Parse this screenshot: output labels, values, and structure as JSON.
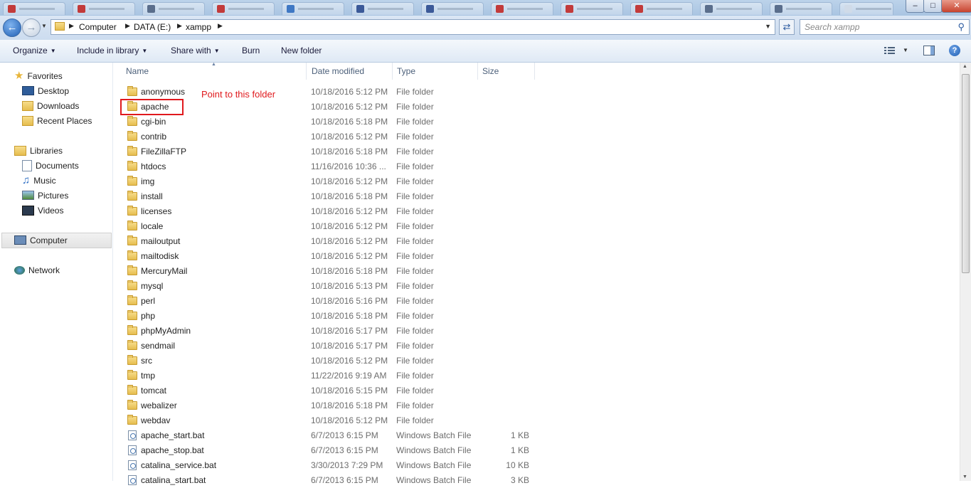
{
  "window": {
    "controls": [
      "–",
      "□",
      "✕"
    ]
  },
  "nav": {
    "back_icon": "back-arrow-icon",
    "forward_icon": "forward-arrow-icon"
  },
  "address": {
    "breadcrumbs": [
      "Computer",
      "DATA (E:)",
      "xampp"
    ]
  },
  "search": {
    "placeholder": "Search xampp"
  },
  "toolbar": {
    "organize": "Organize",
    "include": "Include in library",
    "share": "Share with",
    "burn": "Burn",
    "new_folder": "New folder"
  },
  "sidebar": {
    "favorites": "Favorites",
    "desktop": "Desktop",
    "downloads": "Downloads",
    "recent": "Recent Places",
    "libraries": "Libraries",
    "documents": "Documents",
    "music": "Music",
    "pictures": "Pictures",
    "videos": "Videos",
    "computer": "Computer",
    "network": "Network"
  },
  "columns": {
    "name": "Name",
    "date": "Date modified",
    "type": "Type",
    "size": "Size"
  },
  "files": [
    {
      "name": "anonymous",
      "date": "10/18/2016 5:12 PM",
      "type": "File folder",
      "size": "",
      "kind": "folder"
    },
    {
      "name": "apache",
      "date": "10/18/2016 5:12 PM",
      "type": "File folder",
      "size": "",
      "kind": "folder"
    },
    {
      "name": "cgi-bin",
      "date": "10/18/2016 5:18 PM",
      "type": "File folder",
      "size": "",
      "kind": "folder"
    },
    {
      "name": "contrib",
      "date": "10/18/2016 5:12 PM",
      "type": "File folder",
      "size": "",
      "kind": "folder"
    },
    {
      "name": "FileZillaFTP",
      "date": "10/18/2016 5:18 PM",
      "type": "File folder",
      "size": "",
      "kind": "folder"
    },
    {
      "name": "htdocs",
      "date": "11/16/2016 10:36 ...",
      "type": "File folder",
      "size": "",
      "kind": "folder"
    },
    {
      "name": "img",
      "date": "10/18/2016 5:12 PM",
      "type": "File folder",
      "size": "",
      "kind": "folder"
    },
    {
      "name": "install",
      "date": "10/18/2016 5:18 PM",
      "type": "File folder",
      "size": "",
      "kind": "folder"
    },
    {
      "name": "licenses",
      "date": "10/18/2016 5:12 PM",
      "type": "File folder",
      "size": "",
      "kind": "folder"
    },
    {
      "name": "locale",
      "date": "10/18/2016 5:12 PM",
      "type": "File folder",
      "size": "",
      "kind": "folder"
    },
    {
      "name": "mailoutput",
      "date": "10/18/2016 5:12 PM",
      "type": "File folder",
      "size": "",
      "kind": "folder"
    },
    {
      "name": "mailtodisk",
      "date": "10/18/2016 5:12 PM",
      "type": "File folder",
      "size": "",
      "kind": "folder"
    },
    {
      "name": "MercuryMail",
      "date": "10/18/2016 5:18 PM",
      "type": "File folder",
      "size": "",
      "kind": "folder"
    },
    {
      "name": "mysql",
      "date": "10/18/2016 5:13 PM",
      "type": "File folder",
      "size": "",
      "kind": "folder"
    },
    {
      "name": "perl",
      "date": "10/18/2016 5:16 PM",
      "type": "File folder",
      "size": "",
      "kind": "folder"
    },
    {
      "name": "php",
      "date": "10/18/2016 5:18 PM",
      "type": "File folder",
      "size": "",
      "kind": "folder"
    },
    {
      "name": "phpMyAdmin",
      "date": "10/18/2016 5:17 PM",
      "type": "File folder",
      "size": "",
      "kind": "folder"
    },
    {
      "name": "sendmail",
      "date": "10/18/2016 5:17 PM",
      "type": "File folder",
      "size": "",
      "kind": "folder"
    },
    {
      "name": "src",
      "date": "10/18/2016 5:12 PM",
      "type": "File folder",
      "size": "",
      "kind": "folder"
    },
    {
      "name": "tmp",
      "date": "11/22/2016 9:19 AM",
      "type": "File folder",
      "size": "",
      "kind": "folder"
    },
    {
      "name": "tomcat",
      "date": "10/18/2016 5:15 PM",
      "type": "File folder",
      "size": "",
      "kind": "folder"
    },
    {
      "name": "webalizer",
      "date": "10/18/2016 5:18 PM",
      "type": "File folder",
      "size": "",
      "kind": "folder"
    },
    {
      "name": "webdav",
      "date": "10/18/2016 5:12 PM",
      "type": "File folder",
      "size": "",
      "kind": "folder"
    },
    {
      "name": "apache_start.bat",
      "date": "6/7/2013 6:15 PM",
      "type": "Windows Batch File",
      "size": "1 KB",
      "kind": "bat"
    },
    {
      "name": "apache_stop.bat",
      "date": "6/7/2013 6:15 PM",
      "type": "Windows Batch File",
      "size": "1 KB",
      "kind": "bat"
    },
    {
      "name": "catalina_service.bat",
      "date": "3/30/2013 7:29 PM",
      "type": "Windows Batch File",
      "size": "10 KB",
      "kind": "bat"
    },
    {
      "name": "catalina_start.bat",
      "date": "6/7/2013 6:15 PM",
      "type": "Windows Batch File",
      "size": "3 KB",
      "kind": "bat"
    }
  ],
  "annotation": {
    "text": "Point to this folder",
    "color": "#e0191d"
  }
}
